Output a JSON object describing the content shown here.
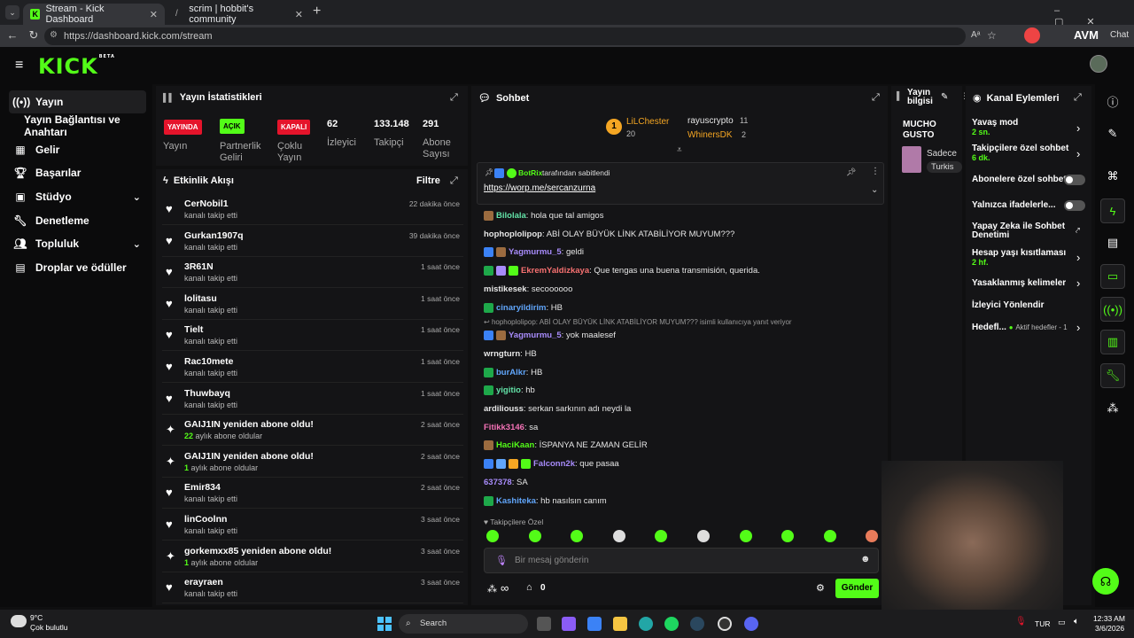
{
  "browser": {
    "tabs": [
      {
        "title": "Stream - Kick Dashboard",
        "active": true
      },
      {
        "title": "scrim | hobbit's community",
        "active": false
      }
    ],
    "new_tab": "+",
    "url": "https://dashboard.kick.com/stream",
    "extension_text": "AVM",
    "chat_label": "Chat"
  },
  "header": {
    "logo": "KICK",
    "logo_sup": "BETA"
  },
  "sidebar": {
    "items": [
      {
        "label": "Yayın",
        "icon": "stream-icon",
        "active": true,
        "sub": false
      },
      {
        "label": "Yayın Bağlantısı ve Anahtarı",
        "icon": "",
        "active": false,
        "sub": true
      },
      {
        "label": "Gelir",
        "icon": "revenue-icon",
        "active": false,
        "sub": false
      },
      {
        "label": "Başarılar",
        "icon": "trophy-icon",
        "active": false,
        "sub": false
      },
      {
        "label": "Stüdyo",
        "icon": "studio-icon",
        "active": false,
        "sub": false,
        "expand": true
      },
      {
        "label": "Denetleme",
        "icon": "wrench-icon",
        "active": false,
        "sub": false
      },
      {
        "label": "Topluluk",
        "icon": "community-icon",
        "active": false,
        "sub": false,
        "expand": true
      },
      {
        "label": "Droplar ve ödüller",
        "icon": "drops-icon",
        "active": false,
        "sub": false
      }
    ]
  },
  "stats": {
    "title": "Yayın İstatistikleri",
    "badges": [
      {
        "text": "YAYINDA",
        "label": "Yayın",
        "color": "#e5142b"
      },
      {
        "text": "AÇIK",
        "label": "Partnerlik Geliri",
        "label_lines": [
          "Partnerlik",
          "Geliri"
        ],
        "color": "#53fc18"
      },
      {
        "text": "KAPALI",
        "label": "Çoklu Yayın",
        "label_lines": [
          "Çoklu",
          "Yayın"
        ],
        "color": "#e5142b"
      }
    ],
    "counts": [
      {
        "value": "62",
        "label": "İzleyici"
      },
      {
        "value": "133.148",
        "label": "Takipçi"
      },
      {
        "value": "291",
        "label_lines": [
          "Abone",
          "Sayısı"
        ]
      }
    ]
  },
  "activity": {
    "title": "Etkinlik Akışı",
    "filter": "Filtre",
    "rows": [
      {
        "name": "CerNobil1",
        "sub": "kanalı takip etti",
        "time": "22 dakika önce",
        "type": "follow"
      },
      {
        "name": "Gurkan1907q",
        "sub": "kanalı takip etti",
        "time": "39 dakika önce",
        "type": "follow"
      },
      {
        "name": "3R61N",
        "sub": "kanalı takip etti",
        "time": "1 saat önce",
        "type": "follow"
      },
      {
        "name": "lolitasu",
        "sub": "kanalı takip etti",
        "time": "1 saat önce",
        "type": "follow"
      },
      {
        "name": "Tielt",
        "sub": "kanalı takip etti",
        "time": "1 saat önce",
        "type": "follow"
      },
      {
        "name": "Rac10mete",
        "sub": "kanalı takip etti",
        "time": "1 saat önce",
        "type": "follow"
      },
      {
        "name": "Thuwbayq",
        "sub": "kanalı takip etti",
        "time": "1 saat önce",
        "type": "follow"
      },
      {
        "name": "GAIJ1IN yeniden abone oldu!",
        "sub_num": "22",
        "sub": "aylık abone oldular",
        "time": "2 saat önce",
        "type": "sub"
      },
      {
        "name": "GAIJ1IN yeniden abone oldu!",
        "sub_num": "1",
        "sub": "aylık abone oldular",
        "time": "2 saat önce",
        "type": "sub"
      },
      {
        "name": "Emir834",
        "sub": "kanalı takip etti",
        "time": "2 saat önce",
        "type": "follow"
      },
      {
        "name": "linCoolnn",
        "sub": "kanalı takip etti",
        "time": "3 saat önce",
        "type": "follow"
      },
      {
        "name": "gorkemxx85 yeniden abone oldu!",
        "sub_num": "1",
        "sub": "aylık abone oldular",
        "time": "3 saat önce",
        "type": "sub"
      },
      {
        "name": "erayraen",
        "sub": "kanalı takip etti",
        "time": "3 saat önce",
        "type": "follow"
      }
    ]
  },
  "chat": {
    "title": "Sohbet",
    "leaderboard": [
      {
        "name": "LiLChester",
        "count": "20",
        "color": "#f5a623"
      },
      {
        "name": "rayuscrypto",
        "count": "11",
        "color": "#e6e6e6"
      },
      {
        "name": "WhinersDK",
        "count": "2",
        "color": "#f5a623"
      }
    ],
    "pinned": {
      "by": "BotRix",
      "suffix": "tarafından sabitlendi",
      "link": "https://worp.me/sercanzurna"
    },
    "messages": [
      {
        "user": "Bilolala",
        "color": "#63e3a8",
        "text": "hola que tal amigos",
        "badges": [
          "#9b6b3f"
        ]
      },
      {
        "user": "hophoplolipop",
        "color": "#e6e6e6",
        "text": "ABİ OLAY BÜYÜK LİNK ATABİLİYOR MUYUM???",
        "badges": []
      },
      {
        "user": "Yagmurmu_5",
        "color": "#a78bfa",
        "text": "geldi",
        "badges": [
          "#3b82f6",
          "#9b6b3f"
        ]
      },
      {
        "user": "EkremYaldizkaya",
        "color": "#f87171",
        "text": "Que tengas una buena transmisión, querida.",
        "badges": [
          "#1ea84a",
          "#a78bfa",
          "#53fc18"
        ]
      },
      {
        "user": "mistikesek",
        "color": "#e6e6e6",
        "text": "secoooooo",
        "badges": []
      },
      {
        "user": "cinaryildirim",
        "color": "#60a5fa",
        "text": "HB",
        "badges": [
          "#1ea84a"
        ]
      },
      {
        "user": "Yagmurmu_5",
        "color": "#a78bfa",
        "text": "yok maalesef",
        "badges": [
          "#3b82f6",
          "#9b6b3f"
        ],
        "reply": "hophoplolipop: ABİ OLAY BÜYÜK LİNK ATABİLİYOR MUYUM??? isimli kullanıcıya yanıt veriyor"
      },
      {
        "user": "wrngturn",
        "color": "#e6e6e6",
        "text": "HB",
        "badges": []
      },
      {
        "user": "burAlkr",
        "color": "#60a5fa",
        "text": "HB",
        "badges": [
          "#1ea84a"
        ]
      },
      {
        "user": "yigitio",
        "color": "#63e3a8",
        "text": "hb",
        "badges": [
          "#1ea84a"
        ]
      },
      {
        "user": "ardiliouss",
        "color": "#e6e6e6",
        "text": "serkan sarkının adı neydi la",
        "badges": []
      },
      {
        "user": "Fitikk3146",
        "color": "#f472b6",
        "text": "sa",
        "badges": []
      },
      {
        "user": "HaciKaan",
        "color": "#53fc18",
        "text": "İSPANYA NE ZAMAN GELİR",
        "badges": [
          "#9b6b3f"
        ]
      },
      {
        "user": "Falconn2k",
        "color": "#a78bfa",
        "text": "que pasaa",
        "badges": [
          "#3b82f6",
          "#60a5fa",
          "#f5a623",
          "#53fc18"
        ]
      },
      {
        "user": "637378",
        "color": "#a78bfa",
        "text": "SA",
        "badges": []
      },
      {
        "user": "Kashiteka",
        "color": "#60a5fa",
        "text": "hb nasılsın canım",
        "badges": [
          "#1ea84a"
        ]
      }
    ],
    "followers_only": "Takipçilere Özel",
    "input_placeholder": "Bir mesaj gönderin",
    "points": "∞",
    "store_count": "0",
    "send": "Gönder"
  },
  "stream_info": {
    "title_lines": [
      "Yayın",
      "bilgisi"
    ],
    "stream_title_lines": [
      "MUCHO",
      "GUSTO"
    ],
    "category": "Sadece",
    "language": "Turkis"
  },
  "channel_actions": {
    "title": "Kanal Eylemleri",
    "rows": [
      {
        "label": "Yavaş mod",
        "value": "2 sn.",
        "control": "chevron"
      },
      {
        "label": "Takipçilere özel sohbet",
        "value": "6 dk.",
        "control": "chevron"
      },
      {
        "label": "Abonelere özel sohbet",
        "value": "",
        "control": "toggle"
      },
      {
        "label": "Yalnızca ifadelerle...",
        "value": "",
        "control": "toggle"
      },
      {
        "label": "Yapay Zeka ile Sohbet Denetimi",
        "label_lines": [
          "Yapay Zeka ile Sohbet",
          "Denetimi"
        ],
        "value": "",
        "control": "external"
      },
      {
        "label": "Hesap yaşı kısıtlaması",
        "value": "2 hf.",
        "control": "chevron"
      },
      {
        "label": "Yasaklanmış kelimeler",
        "value": "",
        "control": "chevron"
      },
      {
        "label": "İzleyici Yönlendir",
        "value": "",
        "control": "none"
      },
      {
        "label": "Hedefl...",
        "value": "Aktif hedefler - 1",
        "control": "chevron"
      }
    ]
  },
  "taskbar": {
    "weather_temp": "9°C",
    "weather_desc": "Çok bulutlu",
    "search": "Search",
    "lang": "TUR",
    "time": "12:33 AM",
    "date": "3/6/2026"
  }
}
